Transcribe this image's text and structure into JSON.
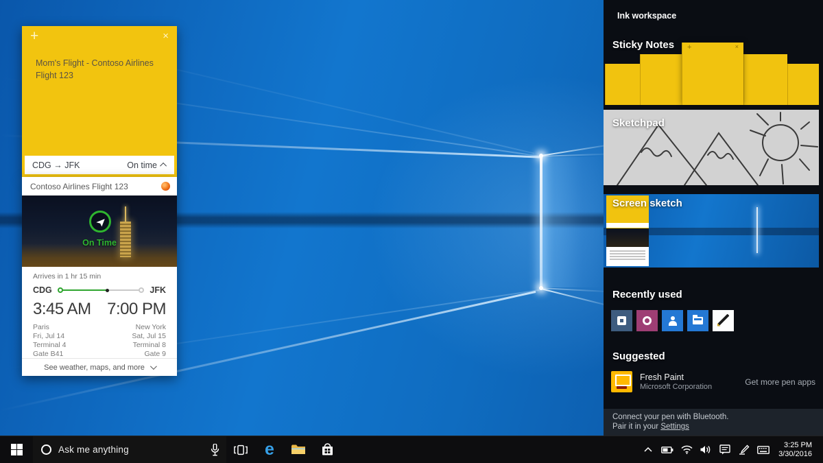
{
  "colors": {
    "sticky_yellow": "#f2c40f",
    "status_green": "#2fb52f",
    "accent_blue": "#2478d4",
    "tile_steel": "#3e5c7f",
    "tile_plum": "#9e3e74",
    "fresh_paint_yellow": "#ffb900",
    "wallpaper_blue": "#1276ce",
    "taskbar_black": "#0d0d0f"
  },
  "sticky_note": {
    "add_icon": "+",
    "close_icon": "×",
    "body": "Mom's Flight - Contoso Airlines Flight 123",
    "insight_route": "CDG → JFK",
    "insight_status": "On time"
  },
  "flight_card": {
    "title": "Contoso Airlines Flight 123",
    "status_overlay": "On Time",
    "arrives_text": "Arrives in 1 hr 15 min",
    "origin_code": "CDG",
    "dest_code": "JFK",
    "origin_time": "3:45 AM",
    "dest_time": "7:00 PM",
    "origin_details": [
      "Paris",
      "Fri, Jul 14",
      "Terminal 4",
      "Gate B41"
    ],
    "dest_details": [
      "New York",
      "Sat, Jul 15",
      "Terminal 8",
      "Gate 9"
    ],
    "progress_percent": 57,
    "expand_text": "See weather, maps, and more"
  },
  "ink_panel": {
    "title": "Ink workspace",
    "sticky_notes_label": "Sticky Notes",
    "note_add_icon": "+",
    "note_close_icon": "×",
    "sketchpad_label": "Sketchpad",
    "screen_sketch_label": "Screen sketch",
    "recently_used_label": "Recently used",
    "suggested_label": "Suggested",
    "suggested_app": {
      "name": "Fresh Paint",
      "publisher": "Microsoft Corporation"
    },
    "get_more_link": "Get more pen apps",
    "footer_line1": "Connect your pen with Bluetooth.",
    "footer_line2_prefix": "Pair it in your ",
    "footer_line2_link": "Settings"
  },
  "taskbar": {
    "search_placeholder": "Ask me anything",
    "edge_glyph": "e",
    "time": "3:25 PM",
    "date": "3/30/2016"
  }
}
